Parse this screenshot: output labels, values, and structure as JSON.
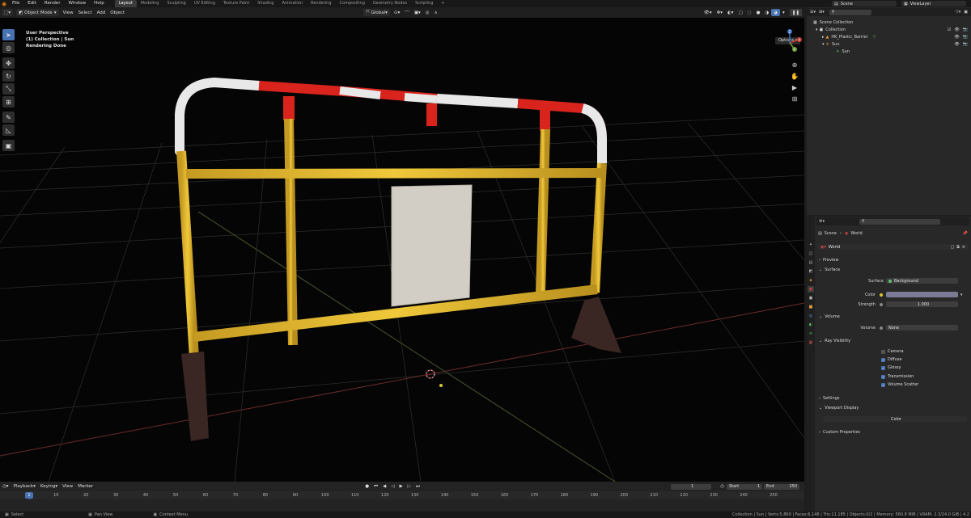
{
  "menu": {
    "items": [
      "File",
      "Edit",
      "Render",
      "Window",
      "Help"
    ]
  },
  "workspaces": {
    "tabs": [
      "Layout",
      "Modeling",
      "Sculpting",
      "UV Editing",
      "Texture Paint",
      "Shading",
      "Animation",
      "Rendering",
      "Compositing",
      "Geometry Nodes",
      "Scripting"
    ],
    "add_label": "+"
  },
  "topright": {
    "scene": "Scene",
    "view_layer": "ViewLayer"
  },
  "viewport_header": {
    "mode": "Object Mode",
    "menus": [
      "View",
      "Select",
      "Add",
      "Object"
    ],
    "orientation": "Global"
  },
  "viewport": {
    "overlay_lines": [
      "User Perspective",
      "(1) Collection | Sun",
      "Rendering Done"
    ],
    "options_label": "Options",
    "gizmo_axes": [
      "X",
      "Y",
      "Z"
    ]
  },
  "outliner": {
    "search_placeholder": "",
    "root": "Scene Collection",
    "items": [
      {
        "label": "Collection",
        "level": 1
      },
      {
        "label": "HK_Plastic_Barrier",
        "level": 2
      },
      {
        "label": "Sun",
        "level": 2
      },
      {
        "label": "Sun",
        "level": 3
      }
    ]
  },
  "properties": {
    "breadcrumb": [
      "Scene",
      "World"
    ],
    "world_name": "World",
    "panels": {
      "preview": "Preview",
      "surface": "Surface",
      "volume": "Volume",
      "ray_visibility": "Ray Visibility",
      "settings": "Settings",
      "viewport_display": "Viewport Display",
      "custom_properties": "Custom Properties"
    },
    "fields": {
      "surface_label": "Surface",
      "surface_value": "Background",
      "color_label": "Color",
      "strength_label": "Strength",
      "strength_value": "1.000",
      "volume_label": "Volume",
      "volume_value": "None",
      "viewport_display_value": "Color"
    },
    "ray_visibility": [
      {
        "label": "Camera",
        "checked": false
      },
      {
        "label": "Diffuse",
        "checked": true
      },
      {
        "label": "Glossy",
        "checked": true
      },
      {
        "label": "Transmission",
        "checked": true
      },
      {
        "label": "Volume Scatter",
        "checked": true
      }
    ],
    "colors": {
      "world_color": "#7a7a94",
      "accent": "#4772b3"
    }
  },
  "timeline": {
    "menus": [
      "Playback",
      "Keying",
      "View",
      "Marker"
    ],
    "current_frame": "1",
    "start_label": "Start",
    "start_value": "1",
    "end_label": "End",
    "end_value": "250",
    "ticks": [
      "10",
      "20",
      "30",
      "40",
      "50",
      "60",
      "70",
      "80",
      "90",
      "100",
      "110",
      "120",
      "130",
      "140",
      "150",
      "160",
      "170",
      "180",
      "190",
      "200",
      "210",
      "220",
      "230",
      "240",
      "250"
    ],
    "playhead": "1"
  },
  "statusbar": {
    "select": "Select",
    "pan": "Pan View",
    "context": "Context Menu",
    "stats": "Collection | Sun | Verts:5,860 | Faces:6,148 | Tris:11,185 | Objects:0/2 | Memory: 560.8 MiB | VRAM: 2.3/24.0 GiB | 4.2"
  }
}
